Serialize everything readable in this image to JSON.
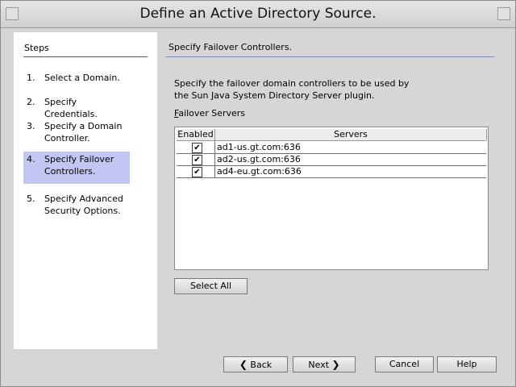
{
  "window": {
    "title": "Define an Active Directory Source."
  },
  "steps": {
    "title": "Steps",
    "items": [
      {
        "num": "1.",
        "label": "Select a Domain."
      },
      {
        "num": "2.",
        "label": "Specify Credentials."
      },
      {
        "num": "3.",
        "label": "Specify a Domain Controller."
      },
      {
        "num": "4.",
        "label": "Specify Failover Controllers."
      },
      {
        "num": "5.",
        "label": "Specify Advanced Security Options."
      }
    ],
    "active_index": 3
  },
  "main": {
    "title": "Specify Failover Controllers.",
    "description": "Specify the failover domain controllers to be used by the Sun Java System Directory Server plugin.",
    "failover_label": "Failover Servers",
    "table": {
      "columns": [
        "Enabled",
        "Servers"
      ],
      "rows": [
        {
          "enabled": true,
          "server": "ad1-us.gt.com:636"
        },
        {
          "enabled": true,
          "server": "ad2-us.gt.com:636"
        },
        {
          "enabled": true,
          "server": "ad4-eu.gt.com:636"
        }
      ]
    },
    "select_all_label": "Select All"
  },
  "footer": {
    "back_label": "Back",
    "next_label": "Next",
    "cancel_label": "Cancel",
    "help_label": "Help"
  },
  "colors": {
    "active_step_bg": "#c4c6f2",
    "rule_color": "#7a8aa6"
  }
}
